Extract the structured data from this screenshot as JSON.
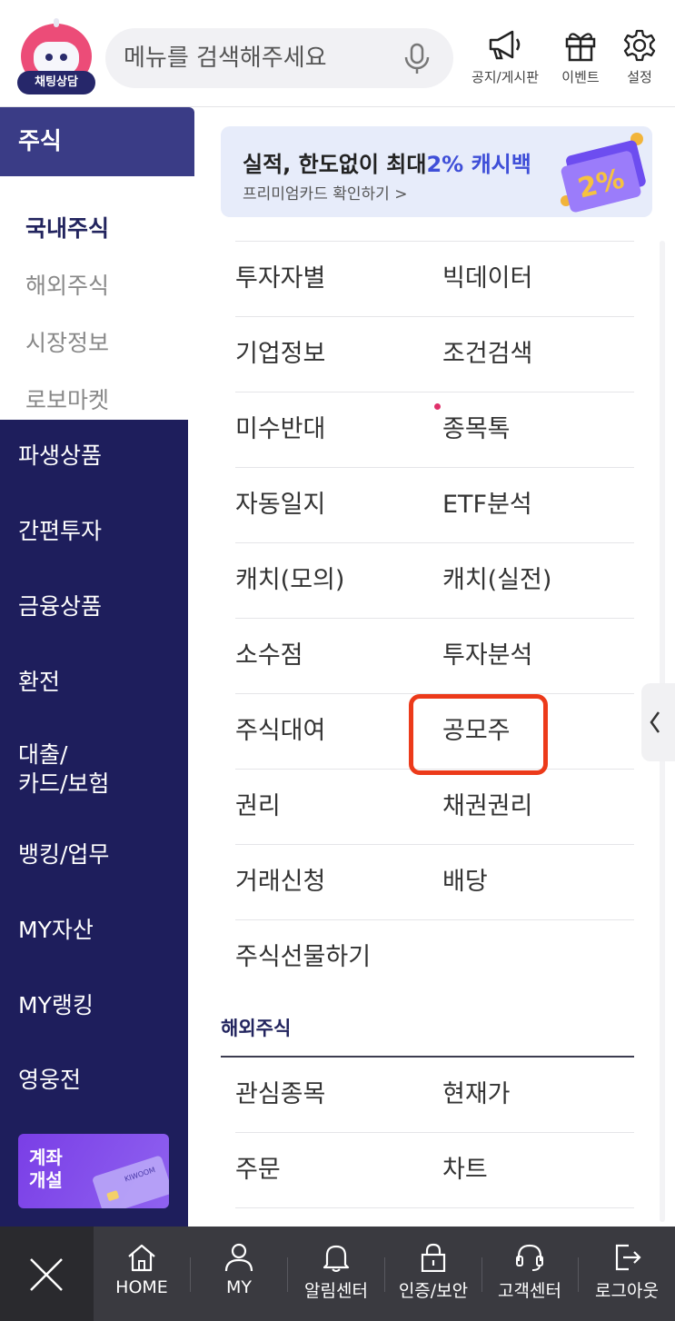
{
  "header": {
    "chatbot_label": "채팅상담",
    "search_placeholder": "메뉴를 검색해주세요",
    "buttons": [
      {
        "label": "공지/게시판",
        "icon": "megaphone-icon"
      },
      {
        "label": "이벤트",
        "icon": "gift-icon"
      },
      {
        "label": "설정",
        "icon": "gear-icon"
      }
    ]
  },
  "sidebar": {
    "section": "주식",
    "sub_items": [
      {
        "label": "국내주식",
        "active": true
      },
      {
        "label": "해외주식",
        "active": false
      },
      {
        "label": "시장정보",
        "active": false
      },
      {
        "label": "로보마켓",
        "active": false
      }
    ],
    "main_items": [
      "파생상품",
      "간편투자",
      "금융상품",
      "환전",
      "대출/\n카드/보험",
      "뱅킹/업무",
      "MY자산",
      "MY랭킹",
      "영웅전"
    ],
    "promo": {
      "line1": "계좌",
      "line2": "개설",
      "card_text": "KIWOOM"
    }
  },
  "banner": {
    "title_prefix": "실적, 한도없이 최대",
    "title_highlight": "2% 캐시백",
    "subtitle": "프리미엄카드 확인하기 >",
    "badge": "2%",
    "accent": "#3f4fd8"
  },
  "domestic_menu": [
    [
      "투자자별",
      "빅데이터"
    ],
    [
      "기업정보",
      "조건검색"
    ],
    [
      "미수반대",
      "종목톡"
    ],
    [
      "자동일지",
      "ETF분석"
    ],
    [
      "캐치(모의)",
      "캐치(실전)"
    ],
    [
      "소수점",
      "투자분석"
    ],
    [
      "주식대여",
      "공모주"
    ],
    [
      "권리",
      "채권권리"
    ],
    [
      "거래신청",
      "배당"
    ],
    [
      "주식선물하기",
      ""
    ]
  ],
  "overseas": {
    "title": "해외주식",
    "menu": [
      [
        "관심종목",
        "현재가"
      ],
      [
        "주문",
        "차트"
      ]
    ]
  },
  "bottom_bar": {
    "tabs": [
      {
        "label": "HOME",
        "icon": "home-icon"
      },
      {
        "label": "MY",
        "icon": "user-icon"
      },
      {
        "label": "알림센터",
        "icon": "bell-icon"
      },
      {
        "label": "인증/보안",
        "icon": "lock-icon"
      },
      {
        "label": "고객센터",
        "icon": "headset-icon"
      },
      {
        "label": "로그아웃",
        "icon": "logout-icon"
      }
    ]
  },
  "colors": {
    "sidebar_bg": "#1e1e5c",
    "sidebar_section": "#3a3c86",
    "highlight_box": "#ec3a1a",
    "bottom_bar": "#3a3a40"
  }
}
